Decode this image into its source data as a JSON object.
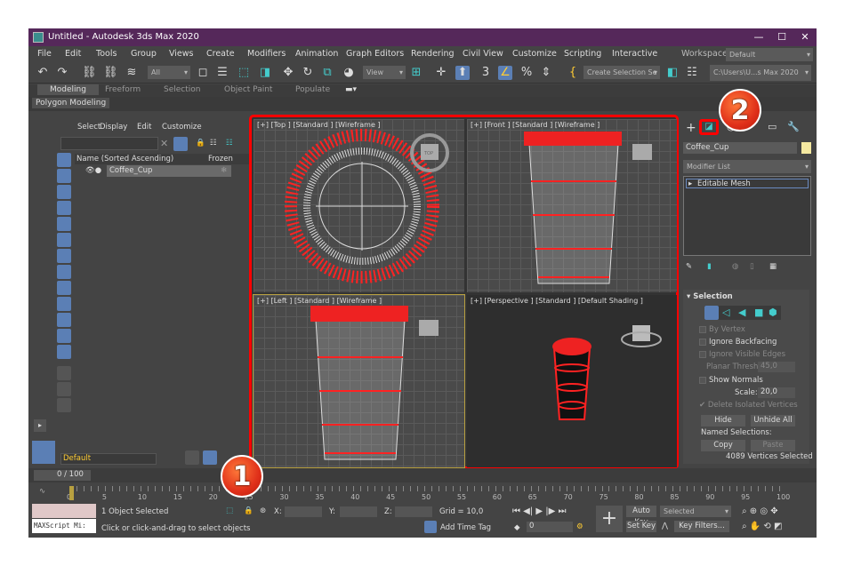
{
  "window": {
    "title": "Untitled - Autodesk 3ds Max 2020",
    "controls": [
      "—",
      "☐",
      "✕"
    ]
  },
  "menu": [
    "File",
    "Edit",
    "Tools",
    "Group",
    "Views",
    "Create",
    "Modifiers",
    "Animation",
    "Graph Editors",
    "Rendering",
    "Civil View",
    "Customize",
    "Scripting",
    "Interactive"
  ],
  "toolbar": {
    "filter": "All",
    "coord": "View",
    "selection_set": "Create Selection Se",
    "workspaces_label": "Workspaces:",
    "workspace": "Default",
    "project_path": "C:\\Users\\U...s Max 2020"
  },
  "ribbon": {
    "tabs": [
      "Modeling",
      "Freeform",
      "Selection",
      "Object Paint",
      "Populate"
    ],
    "active": "Modeling",
    "sub": "Polygon Modeling"
  },
  "explorer": {
    "menu": [
      "Select",
      "Display",
      "Edit",
      "Customize"
    ],
    "col_name": "Name (Sorted Ascending)",
    "col_frozen": "Frozen",
    "items": [
      {
        "name": "Coffee_Cup"
      }
    ],
    "layer": "Default"
  },
  "viewports": [
    {
      "label": "[+] [Top ] [Standard ] [Wireframe ]",
      "cube": "TOP"
    },
    {
      "label": "[+] [Front ] [Standard ] [Wireframe ]",
      "cube": "FRONT"
    },
    {
      "label": "[+] [Left ] [Standard ] [Wireframe ]",
      "cube": "LEFT"
    },
    {
      "label": "[+] [Perspective ] [Standard ] [Default Shading ]",
      "cube": ""
    }
  ],
  "command_panel": {
    "object_name": "Coffee_Cup",
    "modifier_list": "Modifier List",
    "stack": [
      "Editable Mesh"
    ],
    "rollout": "Selection",
    "by_vertex": "By Vertex",
    "ignore_backfacing": "Ignore Backfacing",
    "ignore_visible_edges": "Ignore Visible Edges",
    "planar_label": "Planar Thresh:",
    "planar_value": "45,0",
    "show_normals": "Show Normals",
    "scale_label": "Scale:",
    "scale_value": "20,0",
    "delete_isolated": "Delete Isolated Vertices",
    "hide": "Hide",
    "unhide_all": "Unhide All",
    "named_selections": "Named Selections:",
    "copy": "Copy",
    "paste": "Paste",
    "status": "4089 Vertices Selected"
  },
  "timeline": {
    "frame": "0 / 100",
    "ticks": [
      "0",
      "5",
      "10",
      "15",
      "20",
      "25",
      "30",
      "35",
      "40",
      "45",
      "50",
      "55",
      "60",
      "65",
      "70",
      "75",
      "80",
      "85",
      "90",
      "95",
      "100"
    ]
  },
  "status": {
    "selected": "1 Object Selected",
    "prompt": "Click or click-and-drag to select objects",
    "maxscript": "MAXScript Mi:",
    "x": "X:",
    "y": "Y:",
    "z": "Z:",
    "grid": "Grid = 10,0",
    "add_time_tag": "Add Time Tag",
    "auto_key": "Auto Key",
    "set_key": "Set Key",
    "key_mode": "Selected",
    "key_filters": "Key Filters...",
    "current_frame": "0"
  },
  "annotations": [
    "1",
    "2"
  ],
  "colors": {
    "title_bar": "#55285a",
    "highlight": "#ff0000",
    "accent": "#5b7fb5",
    "badge": "#e0301a"
  }
}
